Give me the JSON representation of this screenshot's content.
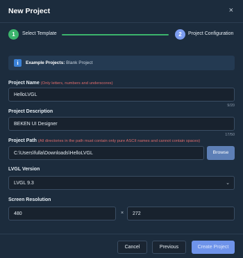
{
  "dialog": {
    "title": "New Project",
    "close_glyph": "×"
  },
  "stepper": {
    "steps": [
      {
        "number": "1",
        "label": "Select Template",
        "status": "complete",
        "color": "#3bb56c"
      },
      {
        "number": "2",
        "label": "Project Configuration",
        "status": "active",
        "color": "#7c9df0"
      }
    ]
  },
  "info": {
    "icon": "info-icon",
    "prefix": "Example Projects:",
    "value": "Blank Project"
  },
  "fields": {
    "name": {
      "label": "Project Name",
      "hint": "(Only letters, numbers and underscores)",
      "value": "HelloLVGL",
      "counter": "9/20"
    },
    "description": {
      "label": "Project Description",
      "value": "BEKEN UI Designer",
      "counter": "17/50"
    },
    "path": {
      "label": "Project Path",
      "hint": "(All directories in the path must contain only pure ASCII names and cannot contain spaces)",
      "value": "C:\\Users\\fulla\\Downloads\\HelloLVGL",
      "browse_label": "Browse"
    },
    "lvgl": {
      "label": "LVGL Version",
      "selected": "LVGL 9.3"
    },
    "resolution": {
      "label": "Screen Resolution",
      "width": "480",
      "separator": "×",
      "height": "272"
    }
  },
  "footer": {
    "cancel_label": "Cancel",
    "previous_label": "Previous",
    "create_label": "Create Project"
  },
  "colors": {
    "accent": "#6e93ea",
    "success": "#3bb56c",
    "hint": "#e06c6c",
    "background": "#1c2c3d"
  }
}
